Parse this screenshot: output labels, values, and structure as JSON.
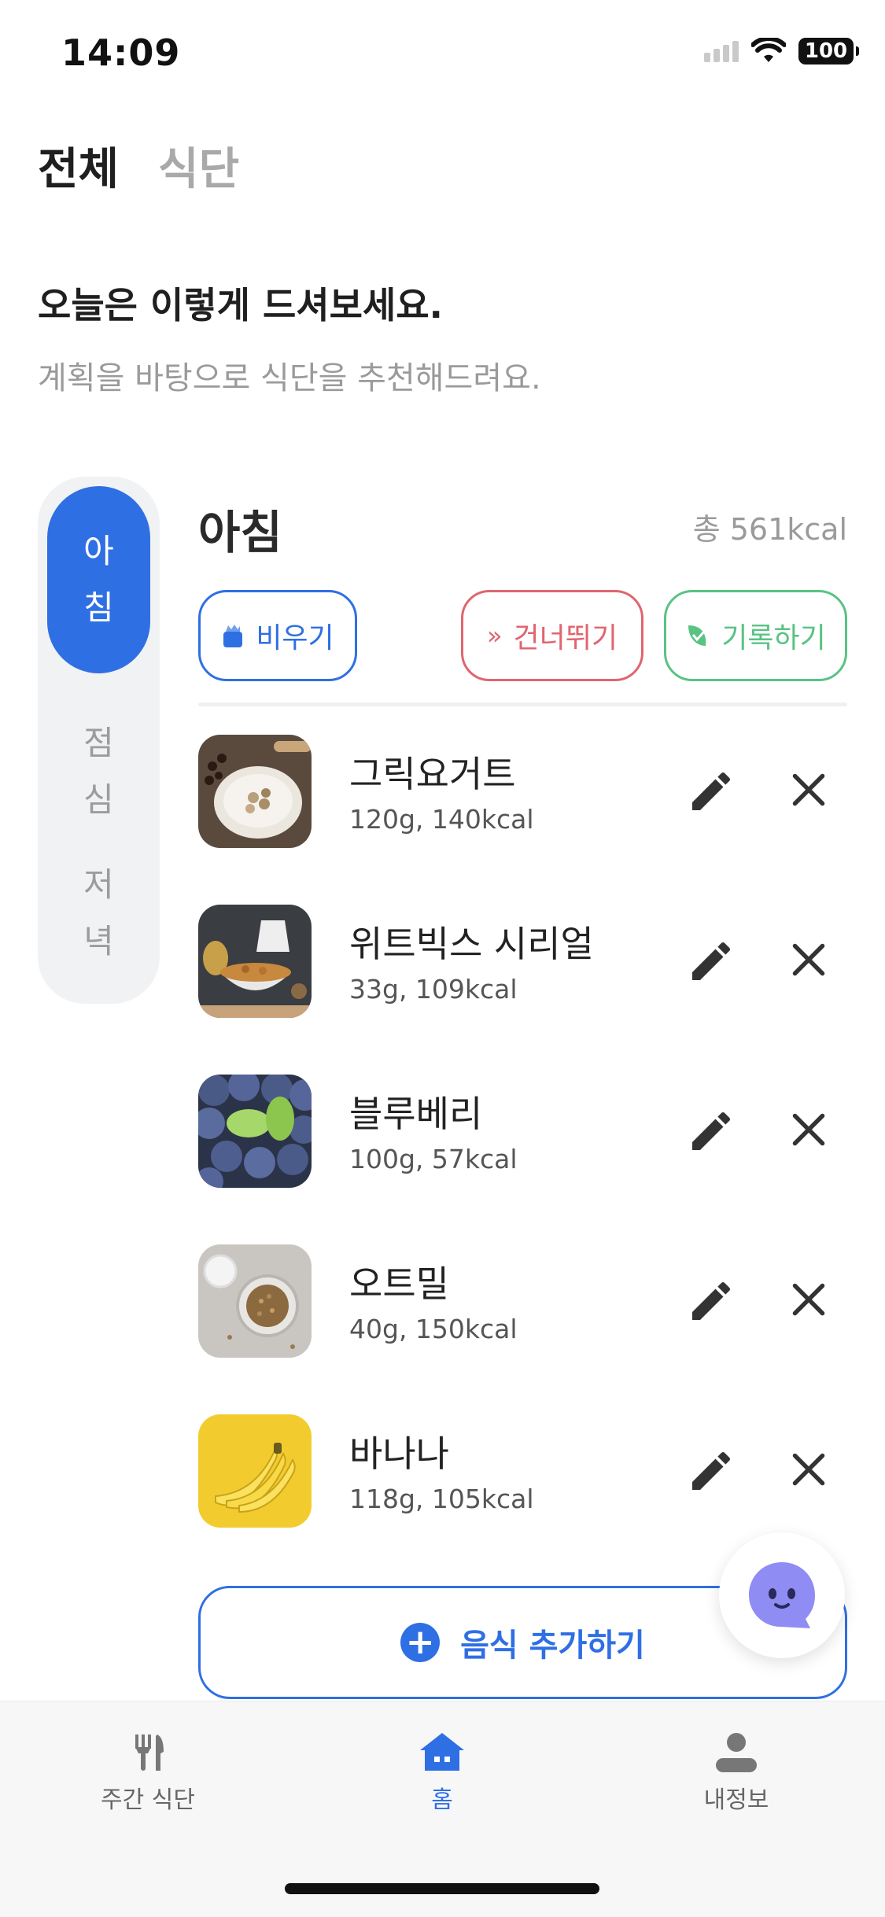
{
  "status_bar": {
    "time": "14:09",
    "battery": "100"
  },
  "top_tabs": [
    {
      "label": "전체",
      "active": true
    },
    {
      "label": "식단",
      "active": false
    }
  ],
  "headline": "오늘은 이렇게 드셔보세요.",
  "subline": "계획을 바탕으로 식단을 추천해드려요.",
  "meal_tabs": [
    {
      "line1": "아",
      "line2": "침"
    },
    {
      "line1": "점",
      "line2": "심"
    },
    {
      "line1": "저",
      "line2": "녁"
    }
  ],
  "meal": {
    "title": "아침",
    "total": "총 561kcal"
  },
  "actions": {
    "empty": "비우기",
    "skip": "건너뛰기",
    "record": "기록하기"
  },
  "foods": [
    {
      "name": "그릭요거트",
      "detail": "120g, 140kcal"
    },
    {
      "name": "위트빅스 시리얼",
      "detail": "33g, 109kcal"
    },
    {
      "name": "블루베리",
      "detail": "100g, 57kcal"
    },
    {
      "name": "오트밀",
      "detail": "40g, 150kcal"
    },
    {
      "name": "바나나",
      "detail": "118g, 105kcal"
    }
  ],
  "add_food_label": "음식 추가하기",
  "bottom_nav": [
    {
      "label": "주간 식단",
      "icon": "utensils-icon",
      "active": false
    },
    {
      "label": "홈",
      "icon": "home-icon",
      "active": true
    },
    {
      "label": "내정보",
      "icon": "user-icon",
      "active": false
    }
  ],
  "colors": {
    "accent": "#2f6fe4",
    "skip": "#e0656f",
    "record": "#59c383"
  }
}
